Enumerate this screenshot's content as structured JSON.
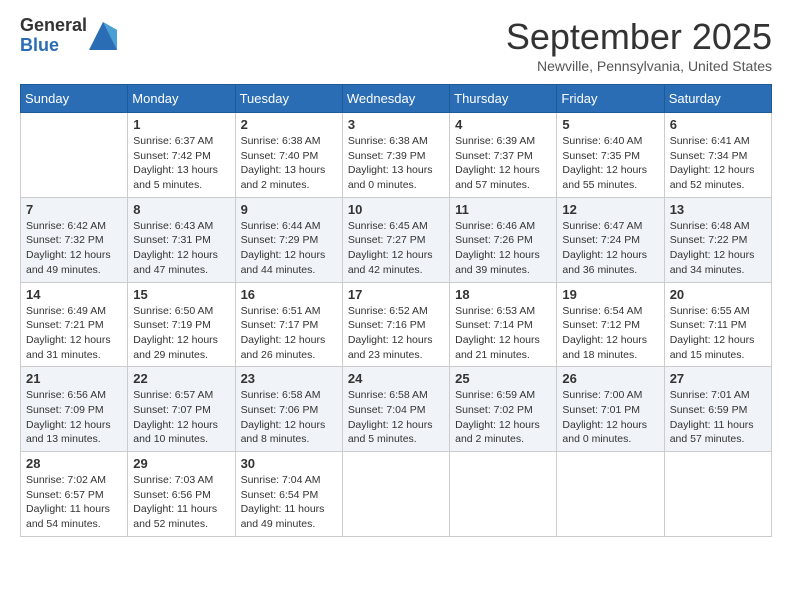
{
  "logo": {
    "general": "General",
    "blue": "Blue"
  },
  "title": "September 2025",
  "location": "Newville, Pennsylvania, United States",
  "days_of_week": [
    "Sunday",
    "Monday",
    "Tuesday",
    "Wednesday",
    "Thursday",
    "Friday",
    "Saturday"
  ],
  "weeks": [
    [
      {
        "day": "",
        "info": ""
      },
      {
        "day": "1",
        "info": "Sunrise: 6:37 AM\nSunset: 7:42 PM\nDaylight: 13 hours\nand 5 minutes."
      },
      {
        "day": "2",
        "info": "Sunrise: 6:38 AM\nSunset: 7:40 PM\nDaylight: 13 hours\nand 2 minutes."
      },
      {
        "day": "3",
        "info": "Sunrise: 6:38 AM\nSunset: 7:39 PM\nDaylight: 13 hours\nand 0 minutes."
      },
      {
        "day": "4",
        "info": "Sunrise: 6:39 AM\nSunset: 7:37 PM\nDaylight: 12 hours\nand 57 minutes."
      },
      {
        "day": "5",
        "info": "Sunrise: 6:40 AM\nSunset: 7:35 PM\nDaylight: 12 hours\nand 55 minutes."
      },
      {
        "day": "6",
        "info": "Sunrise: 6:41 AM\nSunset: 7:34 PM\nDaylight: 12 hours\nand 52 minutes."
      }
    ],
    [
      {
        "day": "7",
        "info": "Sunrise: 6:42 AM\nSunset: 7:32 PM\nDaylight: 12 hours\nand 49 minutes."
      },
      {
        "day": "8",
        "info": "Sunrise: 6:43 AM\nSunset: 7:31 PM\nDaylight: 12 hours\nand 47 minutes."
      },
      {
        "day": "9",
        "info": "Sunrise: 6:44 AM\nSunset: 7:29 PM\nDaylight: 12 hours\nand 44 minutes."
      },
      {
        "day": "10",
        "info": "Sunrise: 6:45 AM\nSunset: 7:27 PM\nDaylight: 12 hours\nand 42 minutes."
      },
      {
        "day": "11",
        "info": "Sunrise: 6:46 AM\nSunset: 7:26 PM\nDaylight: 12 hours\nand 39 minutes."
      },
      {
        "day": "12",
        "info": "Sunrise: 6:47 AM\nSunset: 7:24 PM\nDaylight: 12 hours\nand 36 minutes."
      },
      {
        "day": "13",
        "info": "Sunrise: 6:48 AM\nSunset: 7:22 PM\nDaylight: 12 hours\nand 34 minutes."
      }
    ],
    [
      {
        "day": "14",
        "info": "Sunrise: 6:49 AM\nSunset: 7:21 PM\nDaylight: 12 hours\nand 31 minutes."
      },
      {
        "day": "15",
        "info": "Sunrise: 6:50 AM\nSunset: 7:19 PM\nDaylight: 12 hours\nand 29 minutes."
      },
      {
        "day": "16",
        "info": "Sunrise: 6:51 AM\nSunset: 7:17 PM\nDaylight: 12 hours\nand 26 minutes."
      },
      {
        "day": "17",
        "info": "Sunrise: 6:52 AM\nSunset: 7:16 PM\nDaylight: 12 hours\nand 23 minutes."
      },
      {
        "day": "18",
        "info": "Sunrise: 6:53 AM\nSunset: 7:14 PM\nDaylight: 12 hours\nand 21 minutes."
      },
      {
        "day": "19",
        "info": "Sunrise: 6:54 AM\nSunset: 7:12 PM\nDaylight: 12 hours\nand 18 minutes."
      },
      {
        "day": "20",
        "info": "Sunrise: 6:55 AM\nSunset: 7:11 PM\nDaylight: 12 hours\nand 15 minutes."
      }
    ],
    [
      {
        "day": "21",
        "info": "Sunrise: 6:56 AM\nSunset: 7:09 PM\nDaylight: 12 hours\nand 13 minutes."
      },
      {
        "day": "22",
        "info": "Sunrise: 6:57 AM\nSunset: 7:07 PM\nDaylight: 12 hours\nand 10 minutes."
      },
      {
        "day": "23",
        "info": "Sunrise: 6:58 AM\nSunset: 7:06 PM\nDaylight: 12 hours\nand 8 minutes."
      },
      {
        "day": "24",
        "info": "Sunrise: 6:58 AM\nSunset: 7:04 PM\nDaylight: 12 hours\nand 5 minutes."
      },
      {
        "day": "25",
        "info": "Sunrise: 6:59 AM\nSunset: 7:02 PM\nDaylight: 12 hours\nand 2 minutes."
      },
      {
        "day": "26",
        "info": "Sunrise: 7:00 AM\nSunset: 7:01 PM\nDaylight: 12 hours\nand 0 minutes."
      },
      {
        "day": "27",
        "info": "Sunrise: 7:01 AM\nSunset: 6:59 PM\nDaylight: 11 hours\nand 57 minutes."
      }
    ],
    [
      {
        "day": "28",
        "info": "Sunrise: 7:02 AM\nSunset: 6:57 PM\nDaylight: 11 hours\nand 54 minutes."
      },
      {
        "day": "29",
        "info": "Sunrise: 7:03 AM\nSunset: 6:56 PM\nDaylight: 11 hours\nand 52 minutes."
      },
      {
        "day": "30",
        "info": "Sunrise: 7:04 AM\nSunset: 6:54 PM\nDaylight: 11 hours\nand 49 minutes."
      },
      {
        "day": "",
        "info": ""
      },
      {
        "day": "",
        "info": ""
      },
      {
        "day": "",
        "info": ""
      },
      {
        "day": "",
        "info": ""
      }
    ]
  ]
}
